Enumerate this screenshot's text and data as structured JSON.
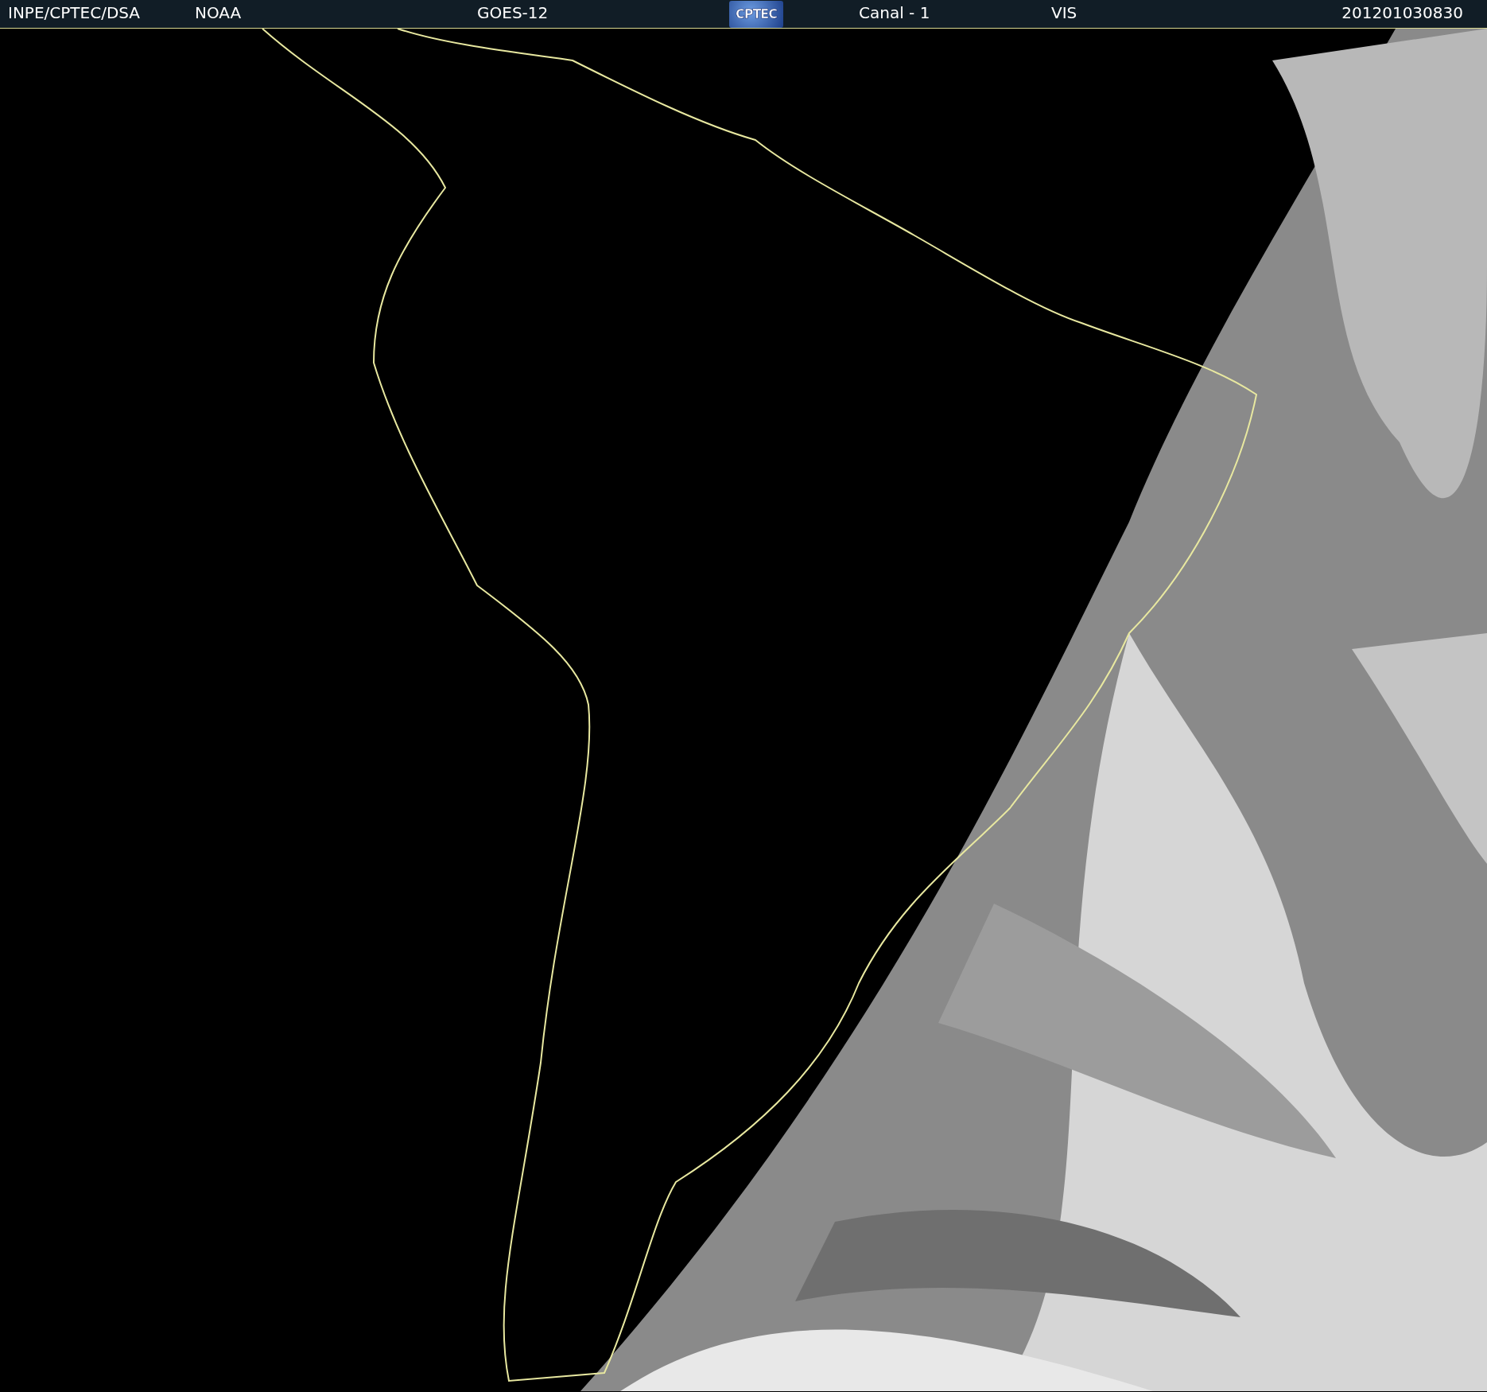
{
  "header": {
    "items": [
      {
        "kind": "text",
        "text": "INPE/CPTEC/DSA"
      },
      {
        "kind": "text",
        "text": "NOAA"
      },
      {
        "kind": "text",
        "text": "GOES-12"
      },
      {
        "kind": "logo",
        "text": "CPTEC"
      },
      {
        "kind": "text",
        "text": "Canal - 1"
      },
      {
        "kind": "text",
        "text": "VIS"
      },
      {
        "kind": "text",
        "text": "201201030830"
      }
    ]
  }
}
